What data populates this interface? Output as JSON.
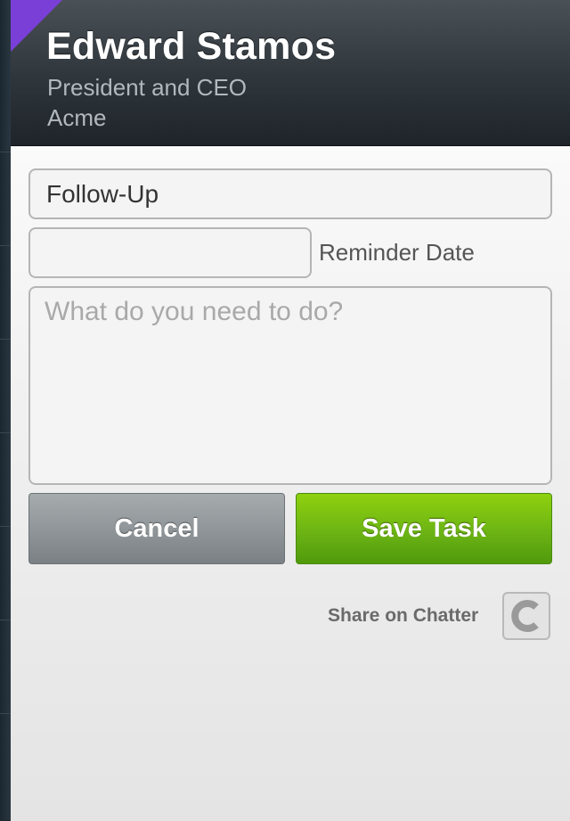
{
  "header": {
    "name": "Edward Stamos",
    "title": "President and CEO",
    "company": "Acme"
  },
  "form": {
    "subject_value": "Follow-Up",
    "reminder_date_value": "",
    "reminder_label": "Reminder Date",
    "notes_placeholder": "What do you need to do?",
    "cancel_label": "Cancel",
    "save_label": "Save Task",
    "share_label": "Share on Chatter",
    "chatter_icon": "chatter-icon"
  },
  "colors": {
    "accent_corner": "#7a3fd6",
    "save_button": "#6cb414",
    "cancel_button": "#8e9497",
    "header_bg": "#2e353b"
  }
}
